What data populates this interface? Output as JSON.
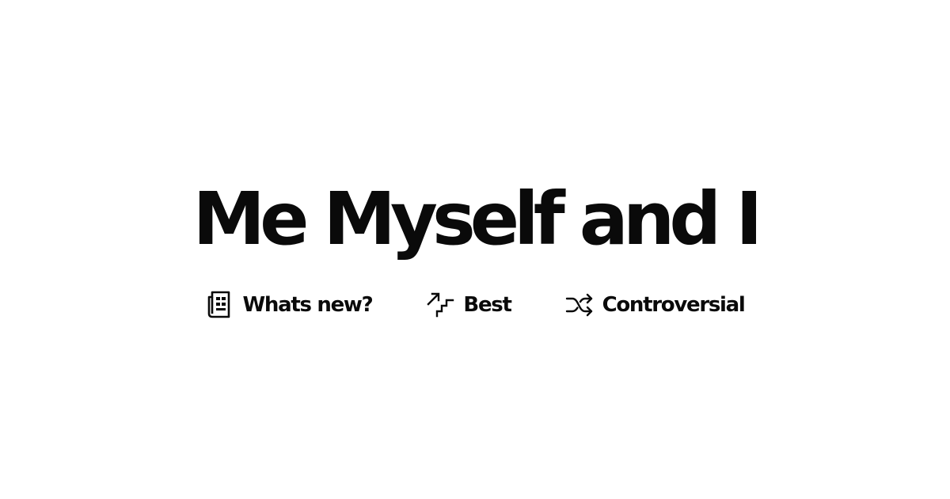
{
  "site": {
    "title": "Me Myself and I"
  },
  "nav": {
    "items": [
      {
        "label": "Whats new?",
        "icon": "newspaper-icon"
      },
      {
        "label": "Best",
        "icon": "stairs-up-icon"
      },
      {
        "label": "Controversial",
        "icon": "shuffle-icon"
      }
    ]
  },
  "colors": {
    "background": "#ffffff",
    "text": "#0a0a0a"
  }
}
